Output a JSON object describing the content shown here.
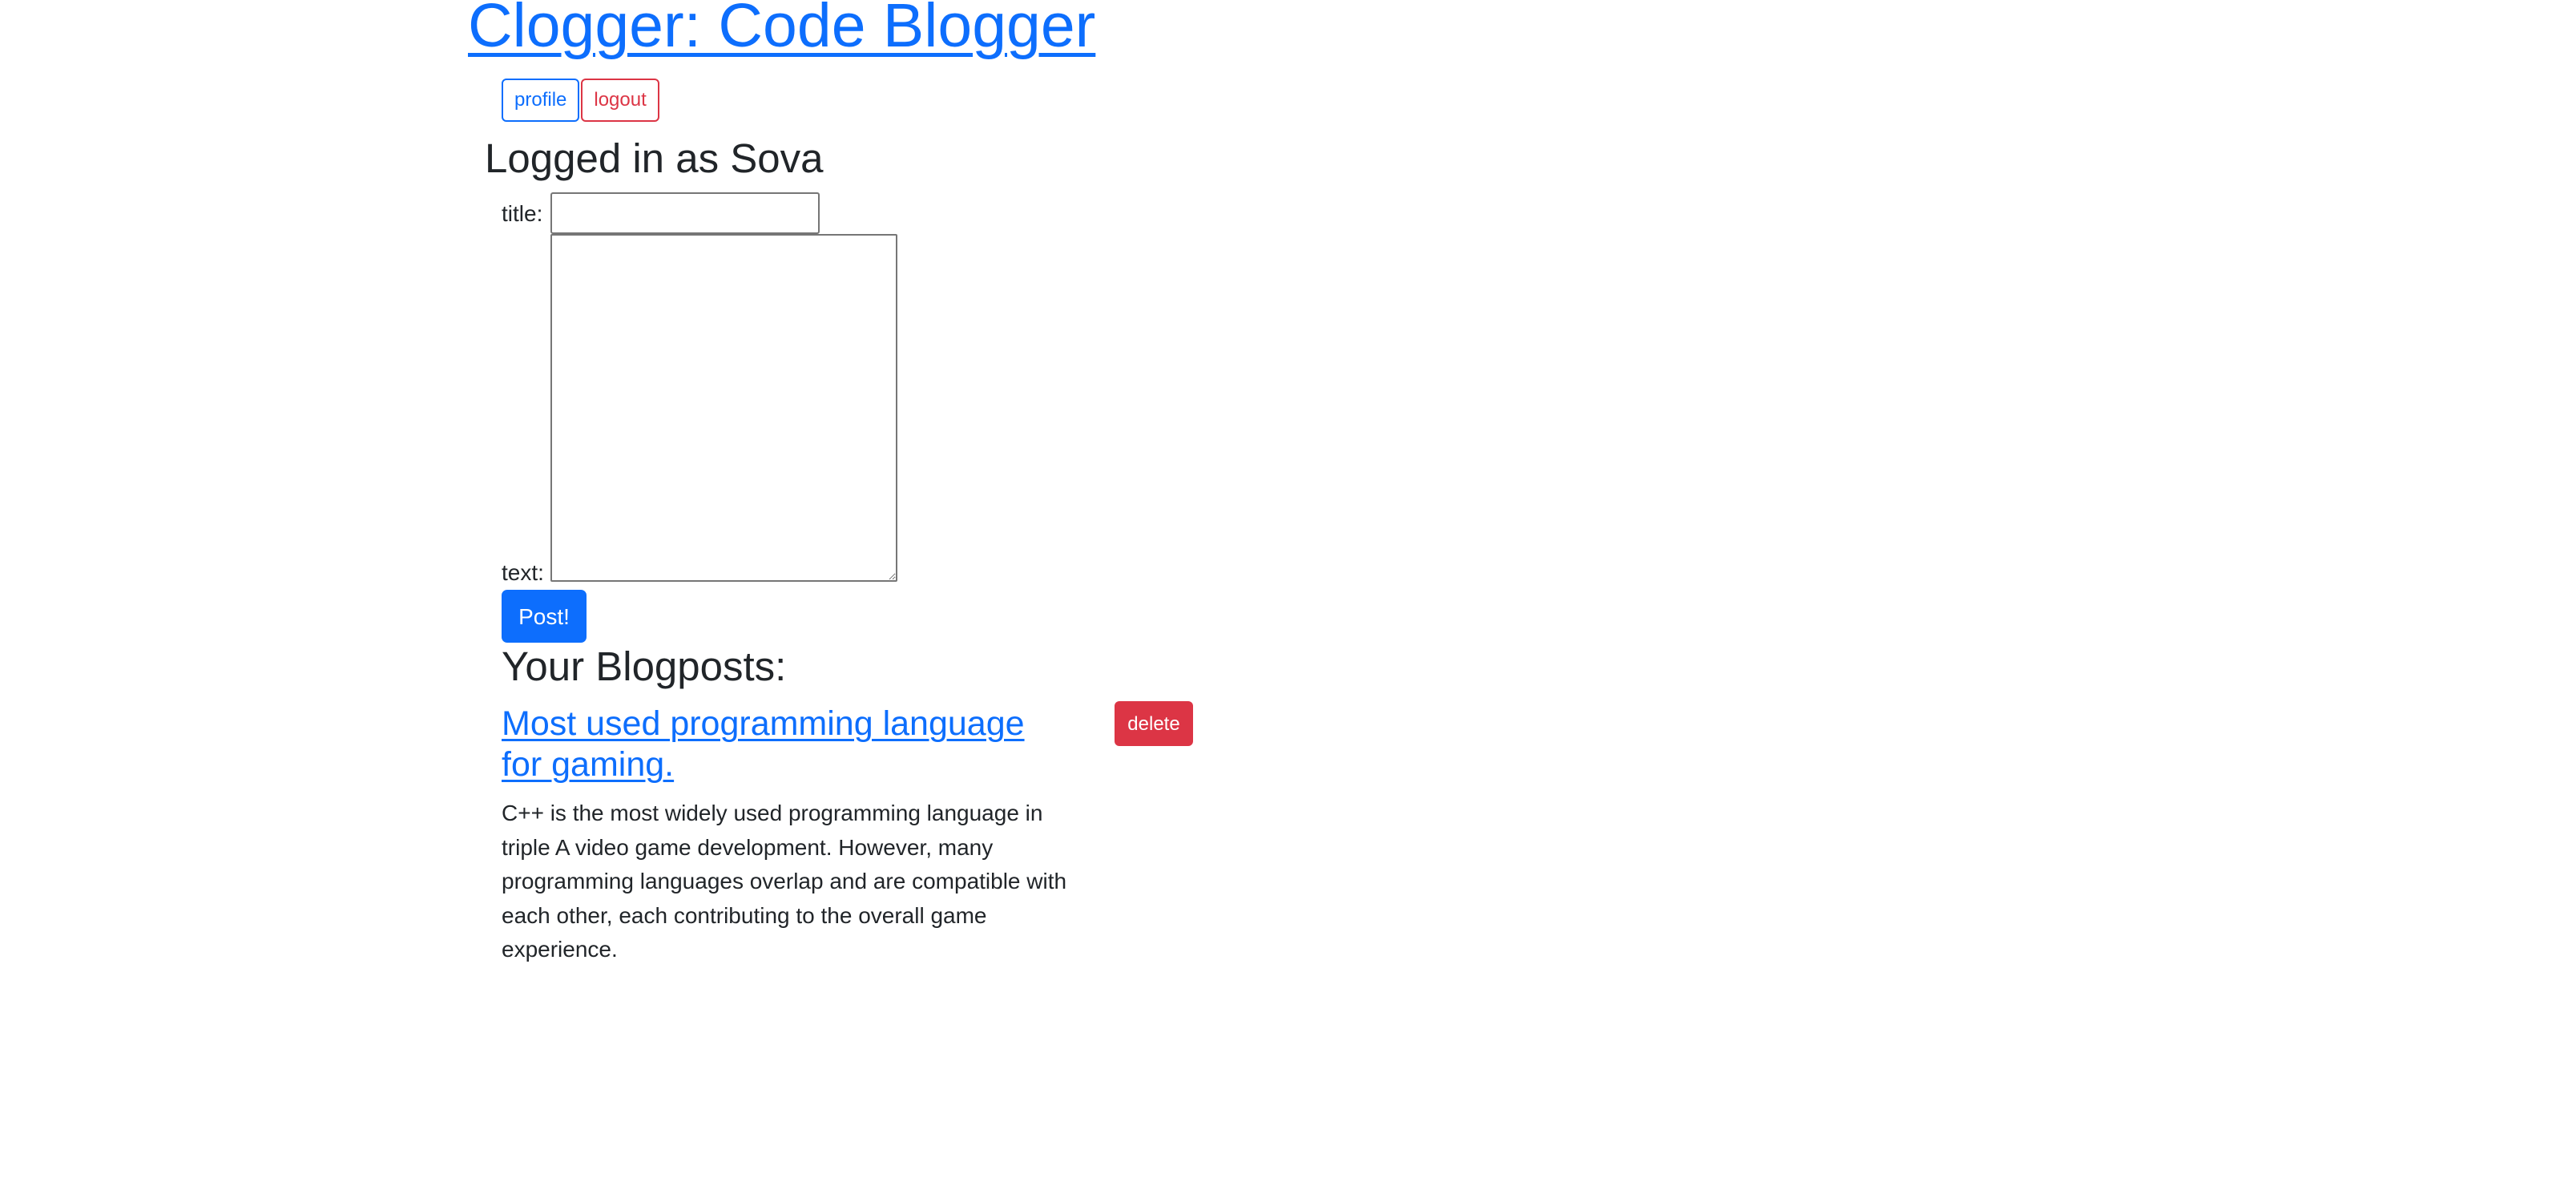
{
  "header": {
    "site_title": "Clogger: Code Blogger"
  },
  "nav": {
    "profile_label": "profile",
    "logout_label": "logout"
  },
  "status": {
    "logged_in_text": "Logged in as Sova"
  },
  "form": {
    "title_label": "title:",
    "title_value": "",
    "text_label": "text:",
    "text_value": "",
    "post_button_label": "Post!"
  },
  "blogposts": {
    "heading": "Your Blogposts:",
    "items": [
      {
        "title": "Most used programming language for gaming.",
        "delete_label": "delete",
        "body": "C++ is the most widely used programming language in triple A video game development. However, many programming languages overlap and are compatible with each other, each contributing to the overall game experience."
      }
    ]
  },
  "colors": {
    "primary": "#0d6efd",
    "danger": "#dc3545",
    "text": "#212529"
  }
}
